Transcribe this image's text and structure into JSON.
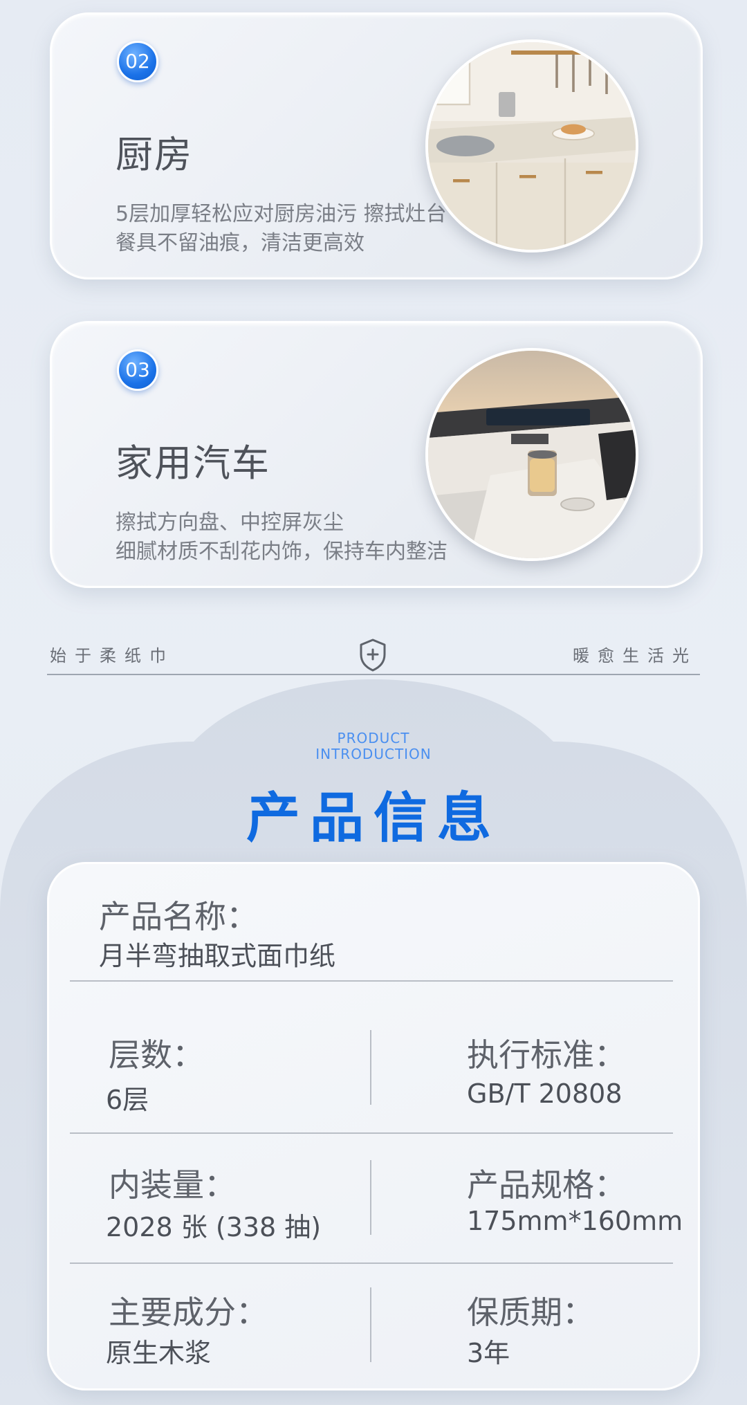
{
  "scenes": [
    {
      "number": "02",
      "title": "厨房",
      "desc_line1": "5层加厚轻松应对厨房油污  擦拭灶台",
      "desc_line2": "餐具不留油痕，清洁更高效",
      "image_icon": "kitchen-photo"
    },
    {
      "number": "03",
      "title": "家用汽车",
      "desc_line1": "擦拭方向盘、中控屏灰尘",
      "desc_line2": "细腻材质不刮花内饰，保持车内整洁",
      "image_icon": "car-interior-photo"
    }
  ],
  "slogan": {
    "left": "始于柔纸巾",
    "right": "暖愈生活光",
    "icon": "shield-plus-icon"
  },
  "section": {
    "en_line1": "PRODUCT",
    "en_line2": "INTRODUCTION",
    "title": "产品信息"
  },
  "info": {
    "name_label": "产品名称：",
    "name_value": "月半弯抽取式面巾纸",
    "rows": [
      {
        "left_label": "层数：",
        "left_value": "6层",
        "right_label": "执行标准：",
        "right_value": "GB/T 20808"
      },
      {
        "left_label": "内装量：",
        "left_value": "2028 张 (338 抽)",
        "right_label": "产品规格：",
        "right_value": "175mm*160mm"
      },
      {
        "left_label": "主要成分：",
        "left_value": "原生木浆",
        "right_label": "保质期：",
        "right_value": "3年"
      }
    ]
  },
  "colors": {
    "accent_blue": "#0f6ae0",
    "badge_blue": "#1b72e8",
    "background": "#e7ecf3"
  }
}
